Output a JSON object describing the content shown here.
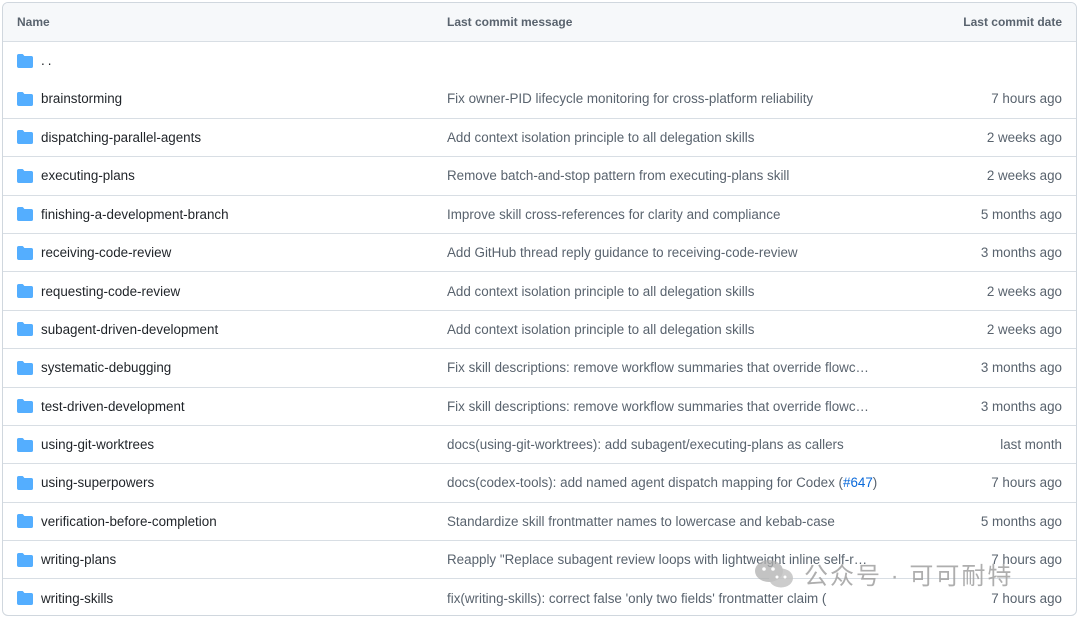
{
  "columns": {
    "name": "Name",
    "message": "Last commit message",
    "date": "Last commit date"
  },
  "parent_dir": "..",
  "rows": [
    {
      "name": "brainstorming",
      "message": "Fix owner-PID lifecycle monitoring for cross-platform reliability",
      "date": "7 hours ago"
    },
    {
      "name": "dispatching-parallel-agents",
      "message": "Add context isolation principle to all delegation skills",
      "date": "2 weeks ago"
    },
    {
      "name": "executing-plans",
      "message": "Remove batch-and-stop pattern from executing-plans skill",
      "date": "2 weeks ago"
    },
    {
      "name": "finishing-a-development-branch",
      "message": "Improve skill cross-references for clarity and compliance",
      "date": "5 months ago"
    },
    {
      "name": "receiving-code-review",
      "message": "Add GitHub thread reply guidance to receiving-code-review",
      "date": "3 months ago"
    },
    {
      "name": "requesting-code-review",
      "message": "Add context isolation principle to all delegation skills",
      "date": "2 weeks ago"
    },
    {
      "name": "subagent-driven-development",
      "message": "Add context isolation principle to all delegation skills",
      "date": "2 weeks ago"
    },
    {
      "name": "systematic-debugging",
      "message": "Fix skill descriptions: remove workflow summaries that override flowc…",
      "date": "3 months ago"
    },
    {
      "name": "test-driven-development",
      "message": "Fix skill descriptions: remove workflow summaries that override flowc…",
      "date": "3 months ago"
    },
    {
      "name": "using-git-worktrees",
      "message": "docs(using-git-worktrees): add subagent/executing-plans as callers",
      "date": "last month"
    },
    {
      "name": "using-superpowers",
      "message": "docs(codex-tools): add named agent dispatch mapping for Codex (",
      "message_issue": "#647",
      "message_suffix": ")",
      "date": "7 hours ago"
    },
    {
      "name": "verification-before-completion",
      "message": "Standardize skill frontmatter names to lowercase and kebab-case",
      "date": "5 months ago"
    },
    {
      "name": "writing-plans",
      "message": "Reapply \"Replace subagent review loops with lightweight inline self-r…",
      "date": "7 hours ago"
    },
    {
      "name": "writing-skills",
      "message": "fix(writing-skills): correct false 'only two fields' frontmatter claim (",
      "date": "7 hours ago"
    }
  ],
  "watermark": "公众号 · 可可耐特",
  "colors": {
    "folder": "#54aeff",
    "link": "#0969da",
    "border": "#d0d7de",
    "header_bg": "#f6f8fa"
  }
}
